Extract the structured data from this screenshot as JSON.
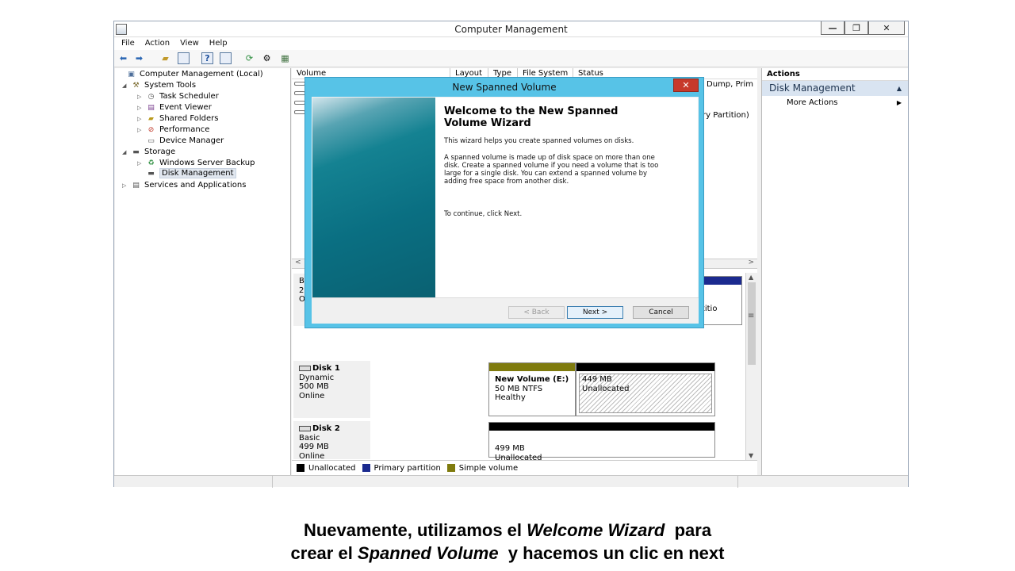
{
  "window": {
    "title": "Computer Management",
    "controls": {
      "minimize": "—",
      "restore": "❐",
      "close": "✕"
    }
  },
  "menu": [
    "File",
    "Action",
    "View",
    "Help"
  ],
  "tree": {
    "items": [
      {
        "label": "Computer Management (Local)",
        "icon": "computer-management-icon",
        "expander": ""
      },
      {
        "label": "System Tools",
        "icon": "system-tools-icon",
        "expander": "◢"
      },
      {
        "label": "Task Scheduler",
        "icon": "clock-icon",
        "expander": "▷"
      },
      {
        "label": "Event Viewer",
        "icon": "event-viewer-icon",
        "expander": "▷"
      },
      {
        "label": "Shared Folders",
        "icon": "shared-folders-icon",
        "expander": "▷"
      },
      {
        "label": "Performance",
        "icon": "performance-icon",
        "expander": "▷"
      },
      {
        "label": "Device Manager",
        "icon": "device-manager-icon",
        "expander": ""
      },
      {
        "label": "Storage",
        "icon": "storage-icon",
        "expander": "◢"
      },
      {
        "label": "Windows Server Backup",
        "icon": "backup-icon",
        "expander": "▷"
      },
      {
        "label": "Disk Management",
        "icon": "disk-management-icon",
        "expander": ""
      },
      {
        "label": "Services and Applications",
        "icon": "services-icon",
        "expander": "▷"
      }
    ]
  },
  "volume_list": {
    "columns": [
      "Volume",
      "Layout",
      "Type",
      "File System",
      "Status"
    ],
    "partial_texts": [
      "Dump, Prim",
      "ry Partition)"
    ]
  },
  "disks": {
    "disk0_partial": {
      "lines": [
        "B",
        "2",
        "O"
      ],
      "partition_partial": "y Partitio"
    },
    "disk1": {
      "name": "Disk 1",
      "type": "Dynamic",
      "size": "500 MB",
      "status": "Online",
      "volumes": [
        {
          "name": "New Volume  (E:)",
          "detail": "50 MB NTFS",
          "state": "Healthy"
        },
        {
          "size": "449 MB",
          "state": "Unallocated"
        }
      ]
    },
    "disk2": {
      "name": "Disk 2",
      "type": "Basic",
      "size": "499 MB",
      "status": "Online",
      "volumes": [
        {
          "size": "499 MB",
          "state": "Unallocated"
        }
      ]
    }
  },
  "legend": [
    {
      "label": "Unallocated",
      "color": "#000000"
    },
    {
      "label": "Primary partition",
      "color": "#1b2a8f"
    },
    {
      "label": "Simple volume",
      "color": "#7f7b0e"
    }
  ],
  "actions_pane": {
    "header": "Actions",
    "section": "Disk Management",
    "more": "More Actions"
  },
  "wizard": {
    "title": "New Spanned Volume",
    "heading_line1": "Welcome to the New Spanned",
    "heading_line2": "Volume Wizard",
    "intro": "This wizard helps you create spanned volumes on disks.",
    "desc_line1": "A spanned volume is made up of disk space on more than one",
    "desc_line2": "disk. Create a spanned volume if you need a volume that is too",
    "desc_line3": "large for a single disk. You can extend a spanned volume by",
    "desc_line4": "adding free space from another disk.",
    "continue": "To continue, click Next.",
    "back": "< Back",
    "next": "Next >",
    "cancel": "Cancel"
  },
  "caption": {
    "line1_a": "Nuevamente, utilizamos el ",
    "line1_b": "Welcome Wizard",
    "line1_c": "  para",
    "line2_a": "crear el ",
    "line2_b": "Spanned Volume",
    "line2_c": "  y hacemos un clic en next"
  },
  "colors": {
    "wizard_frame": "#57c3e7",
    "wizard_close": "#c7392b",
    "simple_volume": "#7f7b0e",
    "primary_partition": "#1b2a8f"
  }
}
